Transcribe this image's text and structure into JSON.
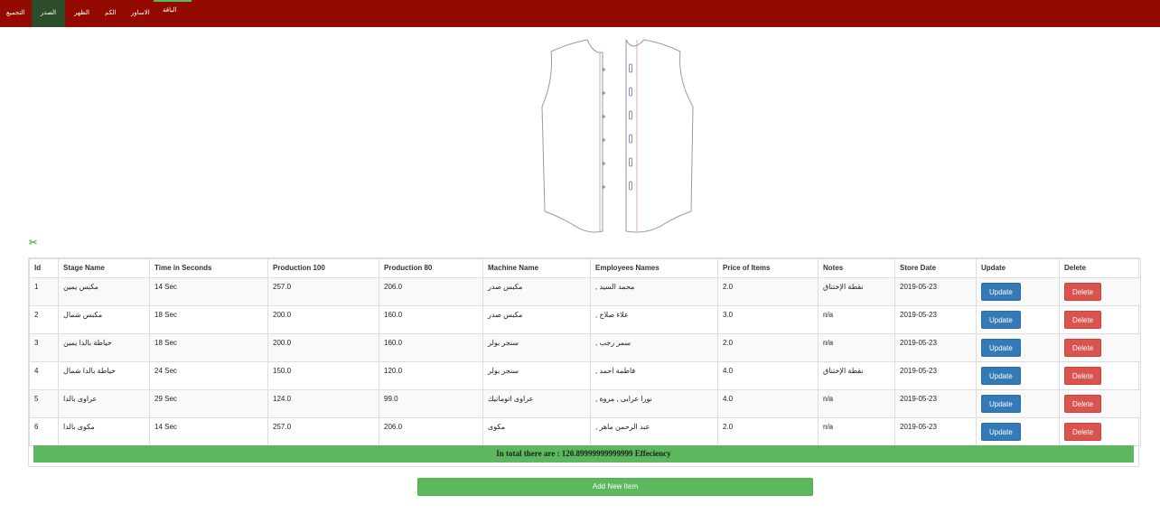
{
  "nav": {
    "items": [
      {
        "label": "التجميع"
      },
      {
        "label": "الصدر",
        "active": true
      },
      {
        "label": "الظهر"
      },
      {
        "label": "الكم"
      },
      {
        "label": "الاساور"
      },
      {
        "label": "الياقة"
      }
    ]
  },
  "colors": {
    "navbar": "#930a00",
    "active_tab": "#2b4d2a",
    "success": "#5cb85c",
    "update": "#337ab7",
    "delete": "#d9534f"
  },
  "illustration": {
    "icon": "shirt-front-icon"
  },
  "table": {
    "headers": [
      "Id",
      "Stage Name",
      "Time in Seconds",
      "Production 100",
      "Production 80",
      "Machine Name",
      "Employees Names",
      "Price of Items",
      "Notes",
      "Store Date",
      "Update",
      "Delete"
    ],
    "rows": [
      {
        "id": "1",
        "stage": "مكبس يمين",
        "time": "14 Sec",
        "p100": "257.0",
        "p80": "206.0",
        "machine": "مكبس صدر",
        "employees": "محمد السيد ,",
        "price": "2.0",
        "notes": "نقطة الإختناق",
        "date": "2019-05-23"
      },
      {
        "id": "2",
        "stage": "مكبس شمال",
        "time": "18 Sec",
        "p100": "200.0",
        "p80": "160.0",
        "machine": "مكبس صدر",
        "employees": "علاء صلاح ,",
        "price": "3.0",
        "notes": "n/a",
        "date": "2019-05-23"
      },
      {
        "id": "3",
        "stage": "خياطة بالدا يمين",
        "time": "18 Sec",
        "p100": "200.0",
        "p80": "160.0",
        "machine": "سنجر بولر",
        "employees": "سمر رجب ,",
        "price": "2.0",
        "notes": "n/a",
        "date": "2019-05-23"
      },
      {
        "id": "4",
        "stage": "خياطة بالدا شمال",
        "time": "24 Sec",
        "p100": "150.0",
        "p80": "120.0",
        "machine": "سنجر بولر",
        "employees": "فاطمة احمد ,",
        "price": "4.0",
        "notes": "نقطة الإختناق",
        "date": "2019-05-23"
      },
      {
        "id": "5",
        "stage": "عراوى بالدا",
        "time": "29 Sec",
        "p100": "124.0",
        "p80": "99.0",
        "machine": "عراوى اتوماتيك",
        "employees": "نورا عرابى , مروة ,",
        "price": "4.0",
        "notes": "n/a",
        "date": "2019-05-23"
      },
      {
        "id": "6",
        "stage": "مكوى بالدا",
        "time": "14 Sec",
        "p100": "257.0",
        "p80": "206.0",
        "machine": "مكوى",
        "employees": "عبد الرحمن ماهر ,",
        "price": "2.0",
        "notes": "n/a",
        "date": "2019-05-23"
      }
    ],
    "update_label": "Update",
    "delete_label": "Delete"
  },
  "summary": "In total there are : 120.89999999999999 Effeciency",
  "add_button": "Add New Item"
}
